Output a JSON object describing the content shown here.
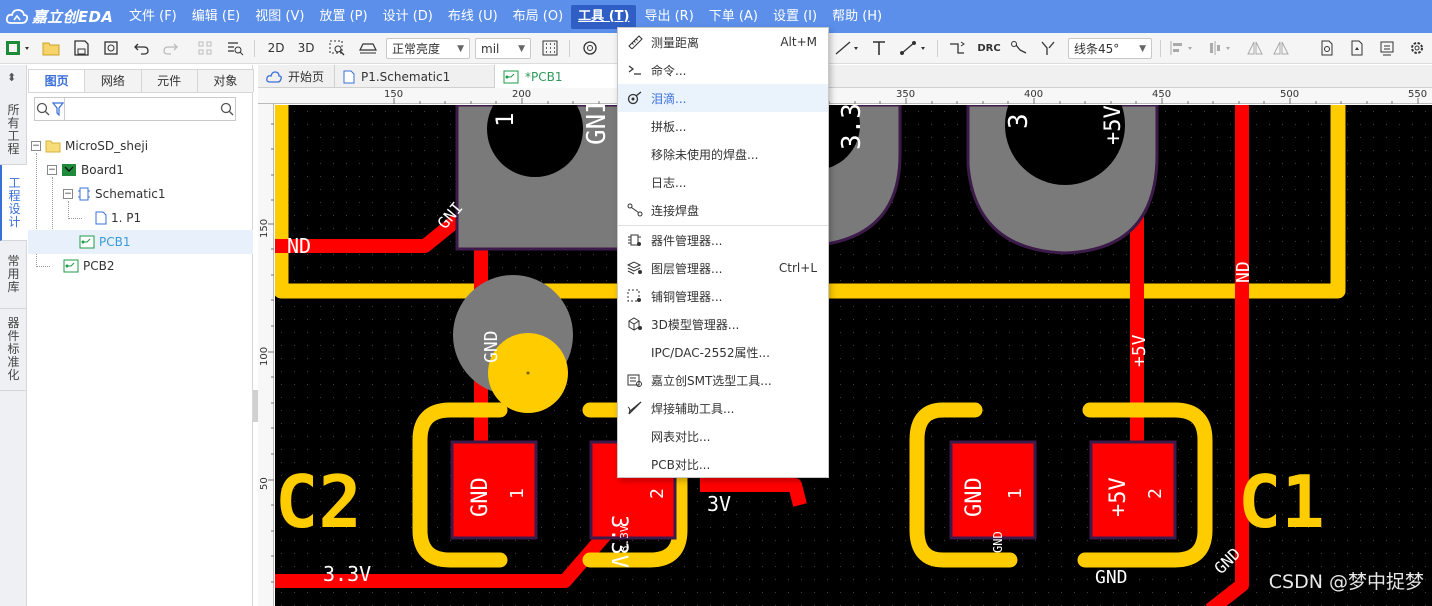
{
  "app": {
    "logo_text": "嘉立创EDA",
    "brand_color": "#5b8fea"
  },
  "menu": [
    {
      "label": "文件 (F)"
    },
    {
      "label": "编辑 (E)"
    },
    {
      "label": "视图 (V)"
    },
    {
      "label": "放置 (P)"
    },
    {
      "label": "设计 (D)"
    },
    {
      "label": "布线 (U)"
    },
    {
      "label": "布局 (O)"
    },
    {
      "label": "工具 (T)"
    },
    {
      "label": "导出 (R)"
    },
    {
      "label": "下单 (A)"
    },
    {
      "label": "设置 (I)"
    },
    {
      "label": "帮助 (H)"
    }
  ],
  "toolbar": {
    "view_2d": "2D",
    "view_3d": "3D",
    "brightness": "正常亮度",
    "unit": "mil",
    "line_mode": "线条45°",
    "drc": "DRC"
  },
  "left_strip": {
    "tabs": [
      "所有工程",
      "工程设计",
      "常用库",
      "器件标准化"
    ]
  },
  "left_panel": {
    "tabs": [
      "图页",
      "网络",
      "元件",
      "对象"
    ],
    "search_placeholder": "",
    "tree": [
      {
        "label": "MicroSD_sheji"
      },
      {
        "label": "Board1"
      },
      {
        "label": "Schematic1"
      },
      {
        "label": "1. P1"
      },
      {
        "label": "PCB1"
      },
      {
        "label": "PCB2"
      }
    ]
  },
  "doc_tabs": [
    "开始页",
    "P1.Schematic1",
    "*PCB1"
  ],
  "ruler": {
    "h_labels": [
      "150",
      "200",
      "350",
      "400",
      "450",
      "500",
      "550"
    ],
    "v_labels": [
      "150",
      "100",
      "50"
    ]
  },
  "pcb": {
    "labels": {
      "nd_left": "ND",
      "gnd_pad_top": "GNI",
      "pin1_top": "1",
      "v33_top": "3.3",
      "pin3_top": "3",
      "v5_top": "+5V",
      "gnd_diag": "GNI",
      "gnd_vert": "GND",
      "v5_vert": "+5V",
      "gnd_right_vert": "ND",
      "c2": "C2",
      "c1": "C1",
      "gnd_c2_pad1": "GND",
      "c2_pin1": "1",
      "c2_pad2": "3.3V",
      "c2_pin2": "2",
      "v33_small": "3.3V",
      "v33_mid": "3V",
      "gnd_c1_pad1": "GND",
      "c1_pin1": "1",
      "gnd_small": "GND",
      "c1_pad2": "+5V",
      "c1_pin2": "2",
      "gnd_bottom": "GND",
      "gnd_diag2": "GND",
      "v33_bottom": "3.3V"
    },
    "colors": {
      "board": "#000000",
      "trace": "#ff0000",
      "silk": "#ffcc00",
      "pad": "#7a7a7a",
      "mask": "#3c1a4a"
    }
  },
  "tools_menu": {
    "items": [
      {
        "label": "测量距离",
        "shortcut": "Alt+M",
        "icon": "ruler-icon"
      },
      {
        "label": "命令...",
        "shortcut": "",
        "icon": "terminal-icon"
      },
      {
        "label": "泪滴...",
        "shortcut": "",
        "icon": "teardrop-icon"
      },
      {
        "label": "拼板...",
        "shortcut": "",
        "icon": ""
      },
      {
        "label": "移除未使用的焊盘...",
        "shortcut": "",
        "icon": ""
      },
      {
        "label": "日志...",
        "shortcut": "",
        "icon": ""
      },
      {
        "label": "连接焊盘",
        "shortcut": "",
        "icon": "connect-pads-icon"
      },
      {
        "label": "器件管理器...",
        "shortcut": "",
        "icon": "component-manager-icon"
      },
      {
        "label": "图层管理器...",
        "shortcut": "Ctrl+L",
        "icon": "layer-manager-icon"
      },
      {
        "label": "铺铜管理器...",
        "shortcut": "",
        "icon": "copper-manager-icon"
      },
      {
        "label": "3D模型管理器...",
        "shortcut": "",
        "icon": "3d-model-icon"
      },
      {
        "label": "IPC/DAC-2552属性...",
        "shortcut": "",
        "icon": ""
      },
      {
        "label": "嘉立创SMT选型工具...",
        "shortcut": "",
        "icon": "smt-icon"
      },
      {
        "label": "焊接辅助工具...",
        "shortcut": "",
        "icon": "solder-icon"
      },
      {
        "label": "网表对比...",
        "shortcut": "",
        "icon": ""
      },
      {
        "label": "PCB对比...",
        "shortcut": "",
        "icon": ""
      }
    ],
    "hover_color": "#eaf2fc"
  },
  "watermark": "CSDN @梦中捉梦"
}
